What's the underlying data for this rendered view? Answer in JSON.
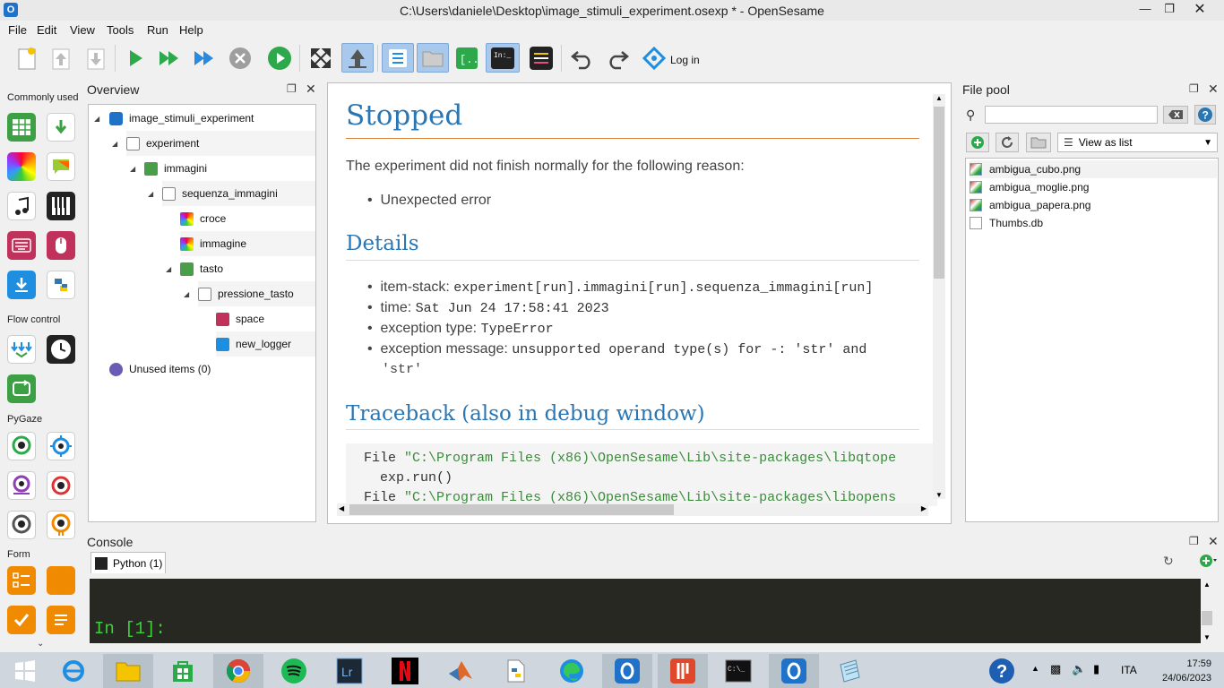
{
  "window": {
    "title": "C:\\Users\\daniele\\Desktop\\image_stimuli_experiment.osexp * - OpenSesame",
    "app_icon_letter": "O"
  },
  "menu": [
    "File",
    "Edit",
    "View",
    "Tools",
    "Run",
    "Help"
  ],
  "toolbar": {
    "login_label": "Log in"
  },
  "left_panel": {
    "sections": [
      "Commonly used",
      "Flow control",
      "PyGaze",
      "Form"
    ]
  },
  "overview": {
    "title": "Overview",
    "tree": [
      {
        "label": "image_stimuli_experiment",
        "icon": "opensesame-icon"
      },
      {
        "label": "experiment",
        "icon": "sequence-icon"
      },
      {
        "label": "immagini",
        "icon": "loop-icon"
      },
      {
        "label": "sequenza_immagini",
        "icon": "sequence-icon"
      },
      {
        "label": "croce",
        "icon": "sketchpad-icon"
      },
      {
        "label": "immagine",
        "icon": "sketchpad-icon"
      },
      {
        "label": "tasto",
        "icon": "loop-icon"
      },
      {
        "label": "pressione_tasto",
        "icon": "sequence-icon"
      },
      {
        "label": "space",
        "icon": "keyboard-icon"
      },
      {
        "label": "new_logger",
        "icon": "logger-icon"
      },
      {
        "label": "Unused items (0)",
        "icon": "unused-icon"
      }
    ]
  },
  "report": {
    "heading": "Stopped",
    "intro": "The experiment did not finish normally for the following reason:",
    "reason": "Unexpected error",
    "details_heading": "Details",
    "details": [
      {
        "label": "item-stack:",
        "value": "experiment[run].immagini[run].sequenza_immagini[run]"
      },
      {
        "label": "time:",
        "value": "Sat Jun 24 17:58:41 2023"
      },
      {
        "label": "exception type:",
        "value": "TypeError"
      },
      {
        "label": "exception message:",
        "value": "unsupported operand type(s) for -: 'str' and",
        "value2": "'str'"
      }
    ],
    "traceback_heading": "Traceback (also in debug window)",
    "traceback": {
      "line1_prefix": "File ",
      "line1_str": "\"C:\\Program Files (x86)\\OpenSesame\\Lib\\site-packages\\libqtope",
      "line2": "  exp.run()",
      "line3_prefix": "File ",
      "line3_str": "\"C:\\Program Files (x86)\\OpenSesame\\Lib\\site-packages\\libopens"
    }
  },
  "file_pool": {
    "title": "File pool",
    "view_option": "View as list",
    "files": [
      "ambigua_cubo.png",
      "ambigua_moglie.png",
      "ambigua_papera.png",
      "Thumbs.db"
    ]
  },
  "console": {
    "title": "Console",
    "tab_label": "Python (1)",
    "prompt": "In [1]:"
  },
  "taskbar": {
    "language": "ITA",
    "time": "17:59",
    "date": "24/06/2023"
  },
  "colors": {
    "accent": "#2a76b3",
    "heading_rule": "#d9823b",
    "console_bg": "#272822",
    "console_prompt": "#39d339"
  }
}
